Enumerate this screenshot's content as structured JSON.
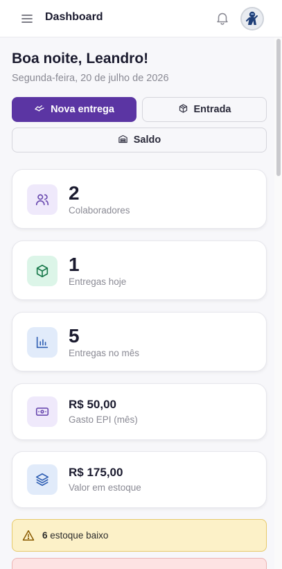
{
  "header": {
    "title": "Dashboard",
    "icons": {
      "menu": "menu-icon",
      "notifications": "bell-icon",
      "avatar": "user-avatar"
    }
  },
  "welcome": {
    "greeting": "Boa noite, Leandro!",
    "date": "Segunda-feira, 20 de julho de 2026"
  },
  "actions": {
    "new_delivery": "Nova entrega",
    "entry": "Entrada",
    "balance": "Saldo"
  },
  "stats": [
    {
      "value": "2",
      "label": "Colaboradores",
      "icon": "users-icon"
    },
    {
      "value": "1",
      "label": "Entregas hoje",
      "icon": "package-icon"
    },
    {
      "value": "5",
      "label": "Entregas no mês",
      "icon": "bar-chart-icon"
    },
    {
      "value": "R$ 50,00",
      "label": "Gasto EPI (mês)",
      "icon": "banknote-icon"
    },
    {
      "value": "R$ 175,00",
      "label": "Valor em estoque",
      "icon": "layers-icon"
    }
  ],
  "alerts": {
    "low_stock_count": "6",
    "low_stock_text": "estoque baixo"
  },
  "colors": {
    "primary": "#5b35a3",
    "purple_icon": "#6b4bb0",
    "green_icon": "#1a7a4c",
    "blue_icon": "#2f5fb3",
    "warning_bg": "#fcf1c8",
    "danger_bg": "#fde3e3"
  }
}
